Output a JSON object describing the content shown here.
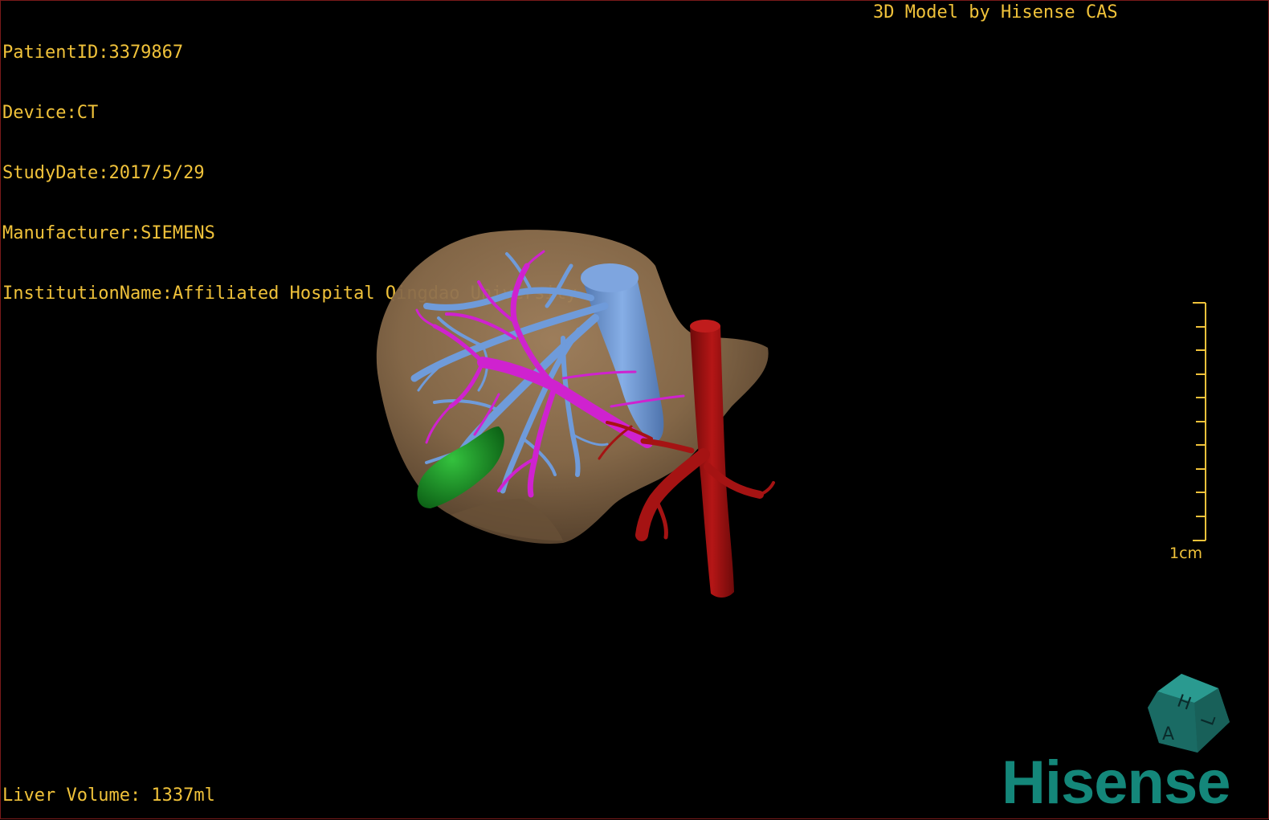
{
  "viewer": {
    "credit": "3D Model by Hisense CAS",
    "patient_id": "PatientID:3379867",
    "device": "Device:CT",
    "study_date": "StudyDate:2017/5/29",
    "manufacturer": "Manufacturer:SIEMENS",
    "institution": "InstitutionName:Affiliated Hospital Qingdao University-C",
    "liver_volume": "Liver Volume: 1337ml"
  },
  "scale_bar": {
    "label": "1cm"
  },
  "orientation_cube": {
    "faces": [
      "H",
      "A",
      "L"
    ]
  },
  "brand": {
    "name": "Hisense"
  },
  "colors": {
    "overlay_text": "#f0c23a",
    "liver": "#8d6f4d",
    "hepatic_vein": "#6b98d8",
    "portal_vein": "#cc22cc",
    "artery_aorta": "#a01010",
    "gallbladder": "#1c9a2a",
    "brand": "#14877a",
    "cube": "#1f7a73"
  }
}
